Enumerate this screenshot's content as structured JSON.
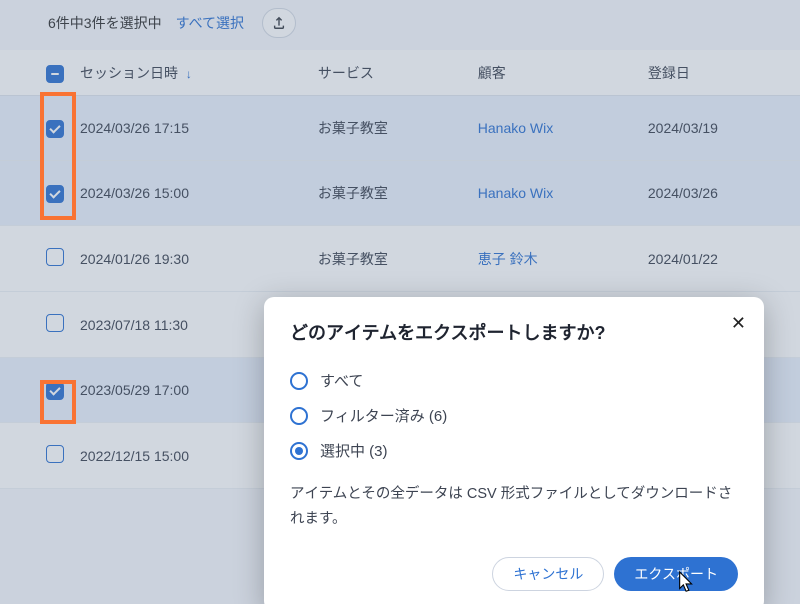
{
  "topbar": {
    "selected_summary": "6件中3件を選択中",
    "select_all": "すべて選択"
  },
  "table": {
    "headers": {
      "datetime": "セッション日時",
      "service": "サービス",
      "customer": "顧客",
      "registered": "登録日"
    },
    "rows": [
      {
        "checked": true,
        "datetime": "2024/03/26 17:15",
        "service": "お菓子教室",
        "customer": "Hanako Wix",
        "registered": "2024/03/19"
      },
      {
        "checked": true,
        "datetime": "2024/03/26 15:00",
        "service": "お菓子教室",
        "customer": "Hanako Wix",
        "registered": "2024/03/26"
      },
      {
        "checked": false,
        "datetime": "2024/01/26 19:30",
        "service": "お菓子教室",
        "customer": "恵子 鈴木",
        "registered": "2024/01/22"
      },
      {
        "checked": false,
        "datetime": "2023/07/18 11:30",
        "service": "",
        "customer": "",
        "registered": ""
      },
      {
        "checked": true,
        "datetime": "2023/05/29 17:00",
        "service": "",
        "customer": "",
        "registered": ""
      },
      {
        "checked": false,
        "datetime": "2022/12/15 15:00",
        "service": "",
        "customer": "",
        "registered": ""
      }
    ]
  },
  "modal": {
    "title": "どのアイテムをエクスポートしますか?",
    "options": {
      "all": "すべて",
      "filtered": "フィルター済み (6)",
      "selected": "選択中 (3)"
    },
    "selected_option": "selected",
    "description": "アイテムとその全データは CSV 形式ファイルとしてダウンロードされます。",
    "cancel": "キャンセル",
    "export": "エクスポート"
  }
}
